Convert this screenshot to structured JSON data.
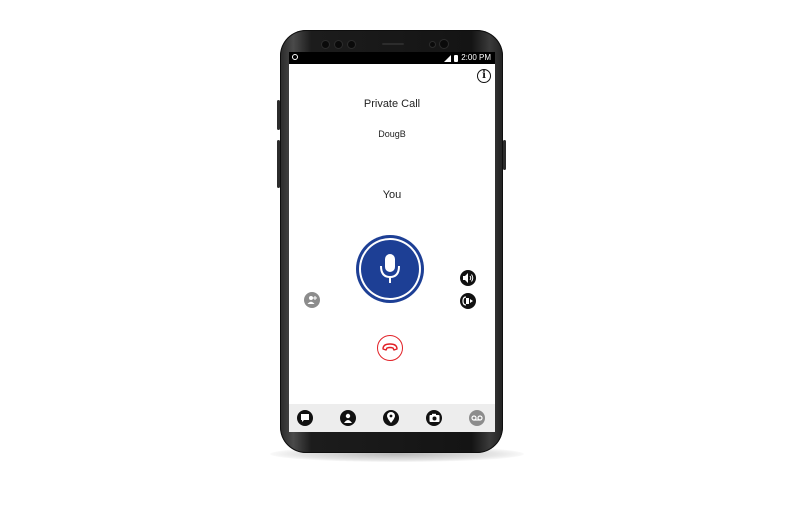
{
  "status_bar": {
    "time": "2:00 PM",
    "icons": [
      "sync-icon",
      "signal-icon",
      "battery-icon"
    ]
  },
  "call": {
    "type": "Private Call",
    "caller": "DougB",
    "talker": "You"
  },
  "controls": {
    "info_glyph": "i",
    "ptt": "microphone-icon",
    "speaker": "speaker-icon",
    "audio_route": "headset-icon",
    "add_user": "add-user-icon",
    "end_call": "hang-up-icon"
  },
  "bottom_nav": [
    "chat-icon",
    "contacts-icon",
    "location-icon",
    "camera-icon",
    "voicemail-icon"
  ],
  "colors": {
    "ptt_blue": "#1d3f95",
    "end_call_red": "#e12026",
    "nav_bg": "#ededed"
  }
}
